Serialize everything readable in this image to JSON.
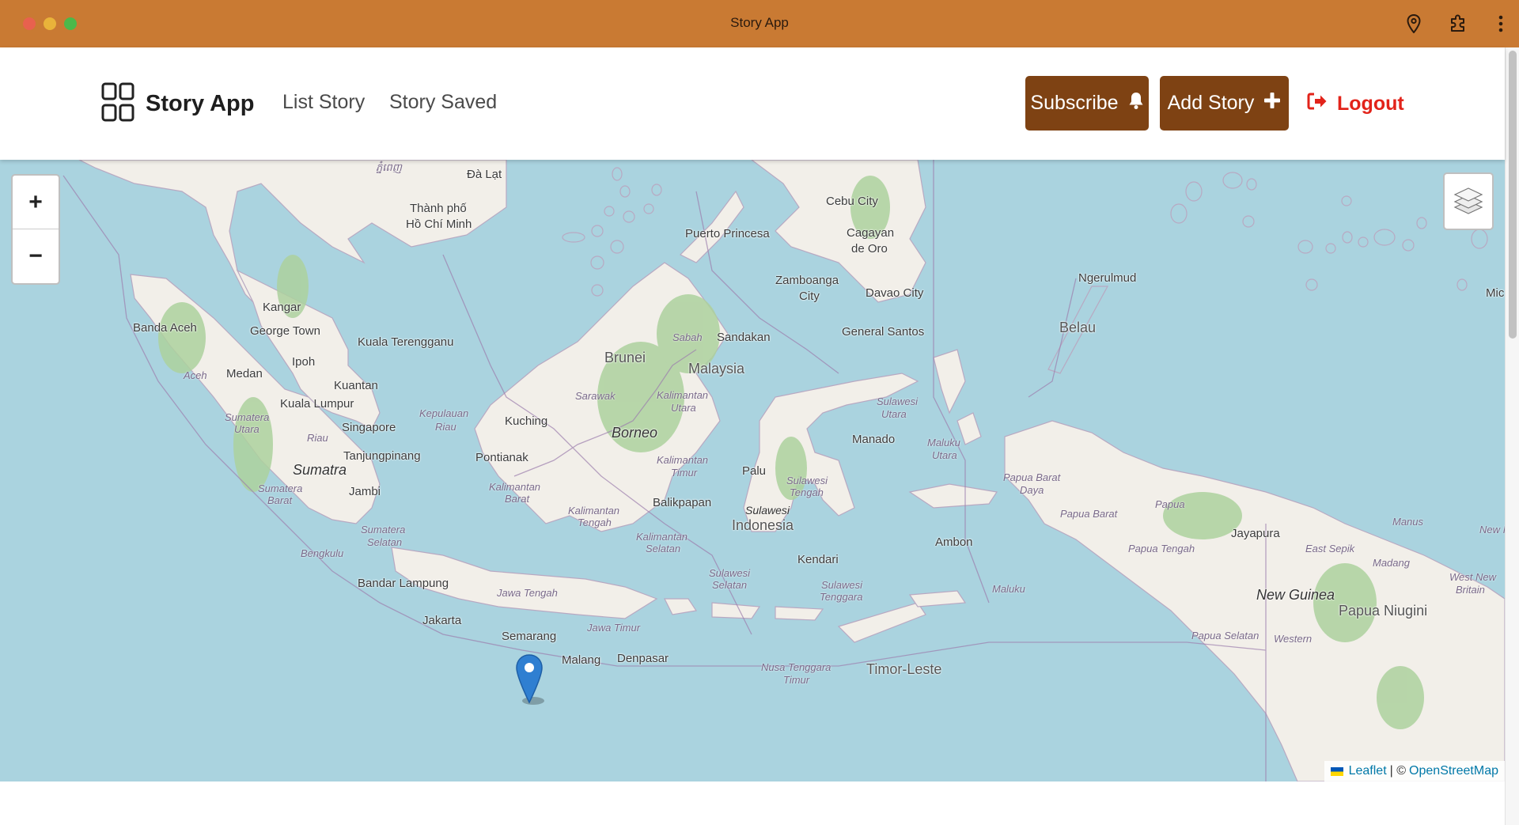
{
  "window": {
    "title": "Story App"
  },
  "browser_toolbar": {
    "icons": [
      "location-pin-icon",
      "puzzle-extension-icon",
      "kebab-menu-icon"
    ]
  },
  "header": {
    "brand": "Story App",
    "brand_icon": "grid-icon",
    "nav": [
      "List Story",
      "Story Saved"
    ],
    "subscribe_label": "Subscribe",
    "subscribe_icon": "bell-icon",
    "add_story_label": "Add Story",
    "add_story_icon": "plus-icon",
    "logout_label": "Logout",
    "logout_icon": "sign-out-icon"
  },
  "colors": {
    "titlebar": "#c97a33",
    "button": "#7e4213",
    "logout": "#e2231a",
    "water": "#aad3df",
    "land": "#f2efe9",
    "forest": "#add19e"
  },
  "map": {
    "zoom_in": "+",
    "zoom_out": "−",
    "layers_icon": "layers-icon",
    "marker_icon": "map-marker-icon",
    "attribution": {
      "leaflet": "Leaflet",
      "separator": "| ©",
      "osm": "OpenStreetMap"
    },
    "labels": {
      "da_lat": "Đà Lạt",
      "hcm1": "Thành phố",
      "hcm2": "Hồ Chí Minh",
      "khmer": "ភ្នំពេញ",
      "cebu": "Cebu City",
      "puerto": "Puerto Princesa",
      "cagayan1": "Cagayan",
      "cagayan2": "de Oro",
      "zamboanga1": "Zamboanga",
      "zamboanga2": "City",
      "davao": "Davao City",
      "gensan": "General Santos",
      "ngerulmud": "Ngerulmud",
      "belau": "Belau",
      "mic": "Mic",
      "kangar": "Kangar",
      "banda_aceh": "Banda Aceh",
      "george_town": "George Town",
      "kuala_terengganu": "Kuala Terengganu",
      "ipoh": "Ipoh",
      "kuantan": "Kuantan",
      "kl": "Kuala Lumpur",
      "medan": "Medan",
      "aceh": "Aceh",
      "singapore": "Singapore",
      "tanjung": "Tanjungpinang",
      "kep1": "Kepulauan",
      "kep2": "Riau",
      "riau": "Riau",
      "sumut1": "Sumatera",
      "sumut2": "Utara",
      "sumatra": "Sumatra",
      "sumbar1": "Sumatera",
      "sumbar2": "Barat",
      "jambi": "Jambi",
      "sumsel1": "Sumatera",
      "sumsel2": "Selatan",
      "bengkulu": "Bengkulu",
      "bandar_lampung": "Bandar Lampung",
      "jakarta": "Jakarta",
      "semarang": "Semarang",
      "jawa_tengah": "Jawa Tengah",
      "jawa_timur": "Jawa Timur",
      "malang": "Malang",
      "denpasar": "Denpasar",
      "kuching": "Kuching",
      "pontianak": "Pontianak",
      "brunei": "Brunei",
      "sabah": "Sabah",
      "sandakan": "Sandakan",
      "malaysia": "Malaysia",
      "sarawak": "Sarawak",
      "kalut1": "Kalimantan",
      "kalut2": "Utara",
      "borneo": "Borneo",
      "kaltim1": "Kalimantan",
      "kaltim2": "Timur",
      "kalbar1": "Kalimantan",
      "kalbar2": "Barat",
      "kalteng1": "Kalimantan",
      "kalteng2": "Tengah",
      "kalsel1": "Kalimantan",
      "kalsel2": "Selatan",
      "balikpapan": "Balikpapan",
      "palu": "Palu",
      "manado": "Manado",
      "sulut1": "Sulawesi",
      "sulut2": "Utara",
      "sulteng1": "Sulawesi",
      "sulteng2": "Tengah",
      "sulawesi": "Sulawesi",
      "indonesia": "Indonesia",
      "sulsel1": "Sulawesi",
      "sulsel2": "Selatan",
      "kendari": "Kendari",
      "sultra1": "Sulawesi",
      "sultra2": "Tenggara",
      "malut1": "Maluku",
      "malut2": "Utara",
      "ambon": "Ambon",
      "maluku": "Maluku",
      "pbd1": "Papua Barat",
      "pbd2": "Daya",
      "papua_barat": "Papua Barat",
      "papua": "Papua",
      "jayapura": "Jayapura",
      "papua_tengah": "Papua Tengah",
      "east_sepik": "East Sepik",
      "manus": "Manus",
      "madang": "Madang",
      "new_guinea": "New Guinea",
      "png": "Papua Niugini",
      "wnb1": "West New",
      "wnb2": "Britain",
      "newi": "New I",
      "papua_selatan": "Papua Selatan",
      "western": "Western",
      "ntt1": "Nusa Tenggara",
      "ntt2": "Timur",
      "timor": "Timor-Leste"
    }
  }
}
